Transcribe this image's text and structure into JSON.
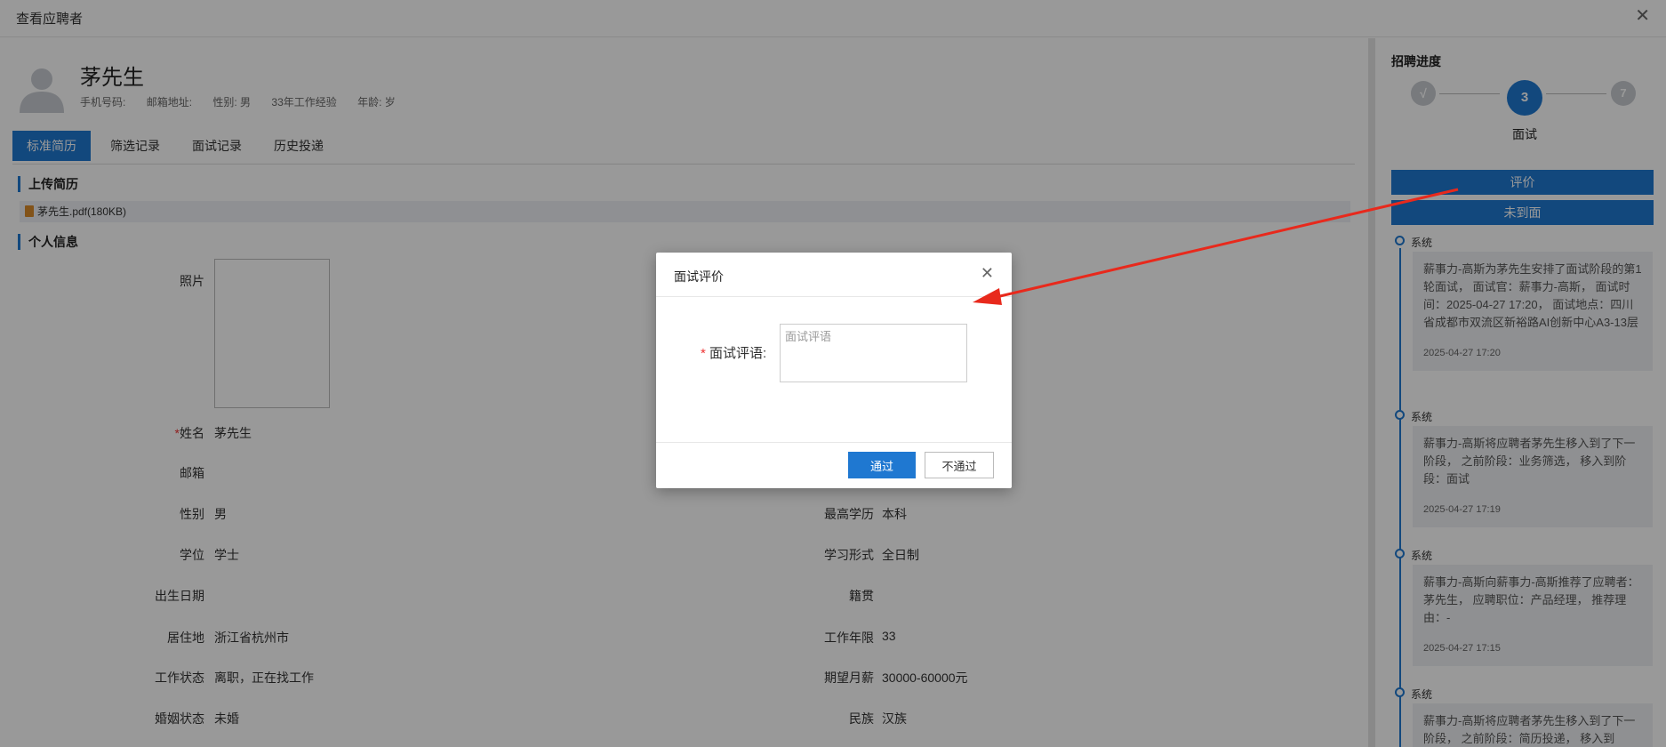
{
  "header": {
    "title": "查看应聘者",
    "close_icon": "close-icon"
  },
  "candidate": {
    "name": "茅先生",
    "phone_label": "手机号码:",
    "email_label": "邮箱地址:",
    "gender_text": "性别: 男",
    "experience_text": "33年工作经验",
    "age_text": "年龄: 岁"
  },
  "tabs": [
    {
      "label": "标准简历",
      "active": true
    },
    {
      "label": "筛选记录",
      "active": false
    },
    {
      "label": "面试记录",
      "active": false
    },
    {
      "label": "历史投递",
      "active": false
    }
  ],
  "upload_section": {
    "title": "上传简历",
    "file_name": "茅先生.pdf(180KB)"
  },
  "personal_section": {
    "title": "个人信息",
    "photo_label": "照片",
    "fields_left": [
      {
        "label": "姓名",
        "required": "*",
        "value": "茅先生"
      },
      {
        "label": "邮箱",
        "value": ""
      },
      {
        "label": "性别",
        "value": "男"
      },
      {
        "label": "学位",
        "value": "学士"
      },
      {
        "label": "出生日期",
        "value": ""
      },
      {
        "label": "居住地",
        "value": "浙江省杭州市"
      },
      {
        "label": "工作状态",
        "value": "离职，正在找工作"
      },
      {
        "label": "婚姻状态",
        "value": "未婚"
      }
    ],
    "fields_right": [
      {
        "label": "最高学历",
        "value": "本科"
      },
      {
        "label": "学习形式",
        "value": "全日制"
      },
      {
        "label": "籍贯",
        "value": ""
      },
      {
        "label": "工作年限",
        "value": "33"
      },
      {
        "label": "期望月薪",
        "value": "30000-60000元"
      },
      {
        "label": "民族",
        "value": "汉族"
      }
    ]
  },
  "progress": {
    "title": "招聘进度",
    "steps": [
      {
        "label": "√"
      },
      {
        "label": "3",
        "caption": "面试"
      },
      {
        "label": "7"
      }
    ],
    "evaluate_button": "评价",
    "no_show_button": "未到面"
  },
  "timeline": [
    {
      "source": "系统",
      "text": "薪事力-高斯为茅先生安排了面试阶段的第1轮面试， 面试官：薪事力-高斯， 面试时间：2025-04-27 17:20， 面试地点：四川省成都市双流区新裕路AI创新中心A3-13层",
      "time": "2025-04-27 17:20"
    },
    {
      "source": "系统",
      "text": "薪事力-高斯将应聘者茅先生移入到了下一阶段， 之前阶段：业务筛选， 移入到阶段：面试",
      "time": "2025-04-27 17:19"
    },
    {
      "source": "系统",
      "text": "薪事力-高斯向薪事力-高斯推荐了应聘者：茅先生， 应聘职位：产品经理， 推荐理由：-",
      "time": "2025-04-27 17:15"
    },
    {
      "source": "系统",
      "text": "薪事力-高斯将应聘者茅先生移入到了下一阶段， 之前阶段：简历投递， 移入到",
      "time": ""
    }
  ],
  "modal": {
    "title": "面试评价",
    "required_mark": "*",
    "field_label": "面试评语:",
    "placeholder": "面试评语",
    "pass_button": "通过",
    "fail_button": "不通过"
  },
  "colors": {
    "accent": "#1f78d1",
    "annotation_arrow": "#e8291c"
  }
}
